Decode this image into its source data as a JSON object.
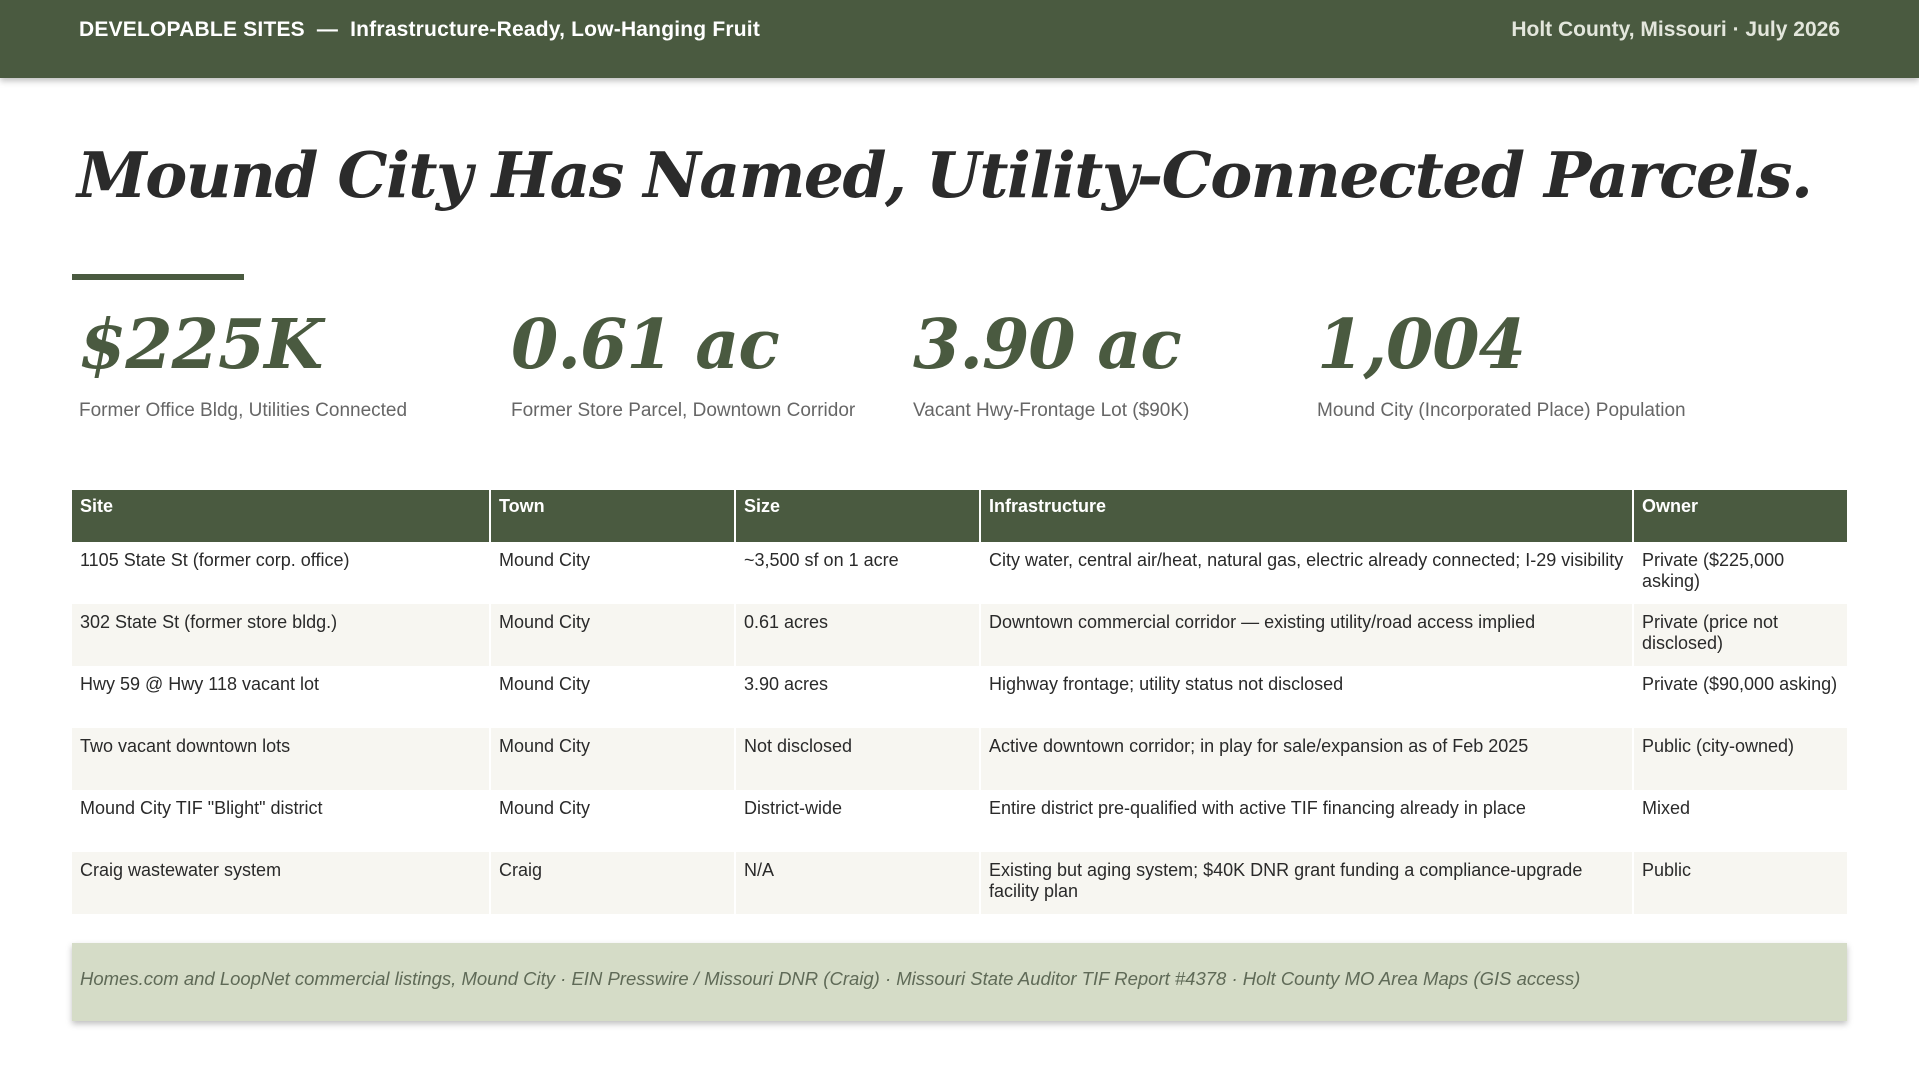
{
  "header": {
    "section": "DEVELOPABLE SITES",
    "separator": "—",
    "subtitle": "Infrastructure-Ready, Low-Hanging Fruit",
    "location_date": "Holt County, Missouri · July 2026"
  },
  "headline": "Mound City Has Named, Utility-Connected Parcels.",
  "stats": [
    {
      "value": "$225K",
      "label": "Former Office Bldg, Utilities Connected"
    },
    {
      "value": "0.61 ac",
      "label": "Former Store Parcel, Downtown Corridor"
    },
    {
      "value": "3.90 ac",
      "label": "Vacant Hwy-Frontage Lot ($90K)"
    },
    {
      "value": "1,004",
      "label": "Mound City (Incorporated Place) Population"
    }
  ],
  "table": {
    "columns": [
      "Site",
      "Town",
      "Size",
      "Infrastructure",
      "Owner"
    ],
    "rows": [
      [
        "1105 State St (former corp. office)",
        "Mound City",
        "~3,500 sf on 1 acre",
        "City water, central air/heat, natural gas, electric already connected; I-29 visibility",
        "Private ($225,000 asking)"
      ],
      [
        "302 State St (former store bldg.)",
        "Mound City",
        "0.61 acres",
        "Downtown commercial corridor — existing utility/road access implied",
        "Private (price not disclosed)"
      ],
      [
        "Hwy 59 @ Hwy 118 vacant lot",
        "Mound City",
        "3.90 acres",
        "Highway frontage; utility status not disclosed",
        "Private ($90,000 asking)"
      ],
      [
        "Two vacant downtown lots",
        "Mound City",
        "Not disclosed",
        "Active downtown corridor; in play for sale/expansion as of Feb 2025",
        "Public (city-owned)"
      ],
      [
        "Mound City TIF \"Blight\" district",
        "Mound City",
        "District-wide",
        "Entire district pre-qualified with active TIF financing already in place",
        "Mixed"
      ],
      [
        "Craig wastewater system",
        "Craig",
        "N/A",
        "Existing but aging system; $40K DNR grant funding a compliance-upgrade facility plan",
        "Public"
      ]
    ]
  },
  "sources": "Homes.com and LoopNet commercial listings, Mound City · EIN Presswire / Missouri DNR (Craig) · Missouri State Auditor TIF Report #4378 · Holt County MO Area Maps (GIS access)",
  "colors": {
    "brand_green": "#4a5a40",
    "sources_bg": "#d5dcc7",
    "alt_row_bg": "#f7f6f1"
  }
}
